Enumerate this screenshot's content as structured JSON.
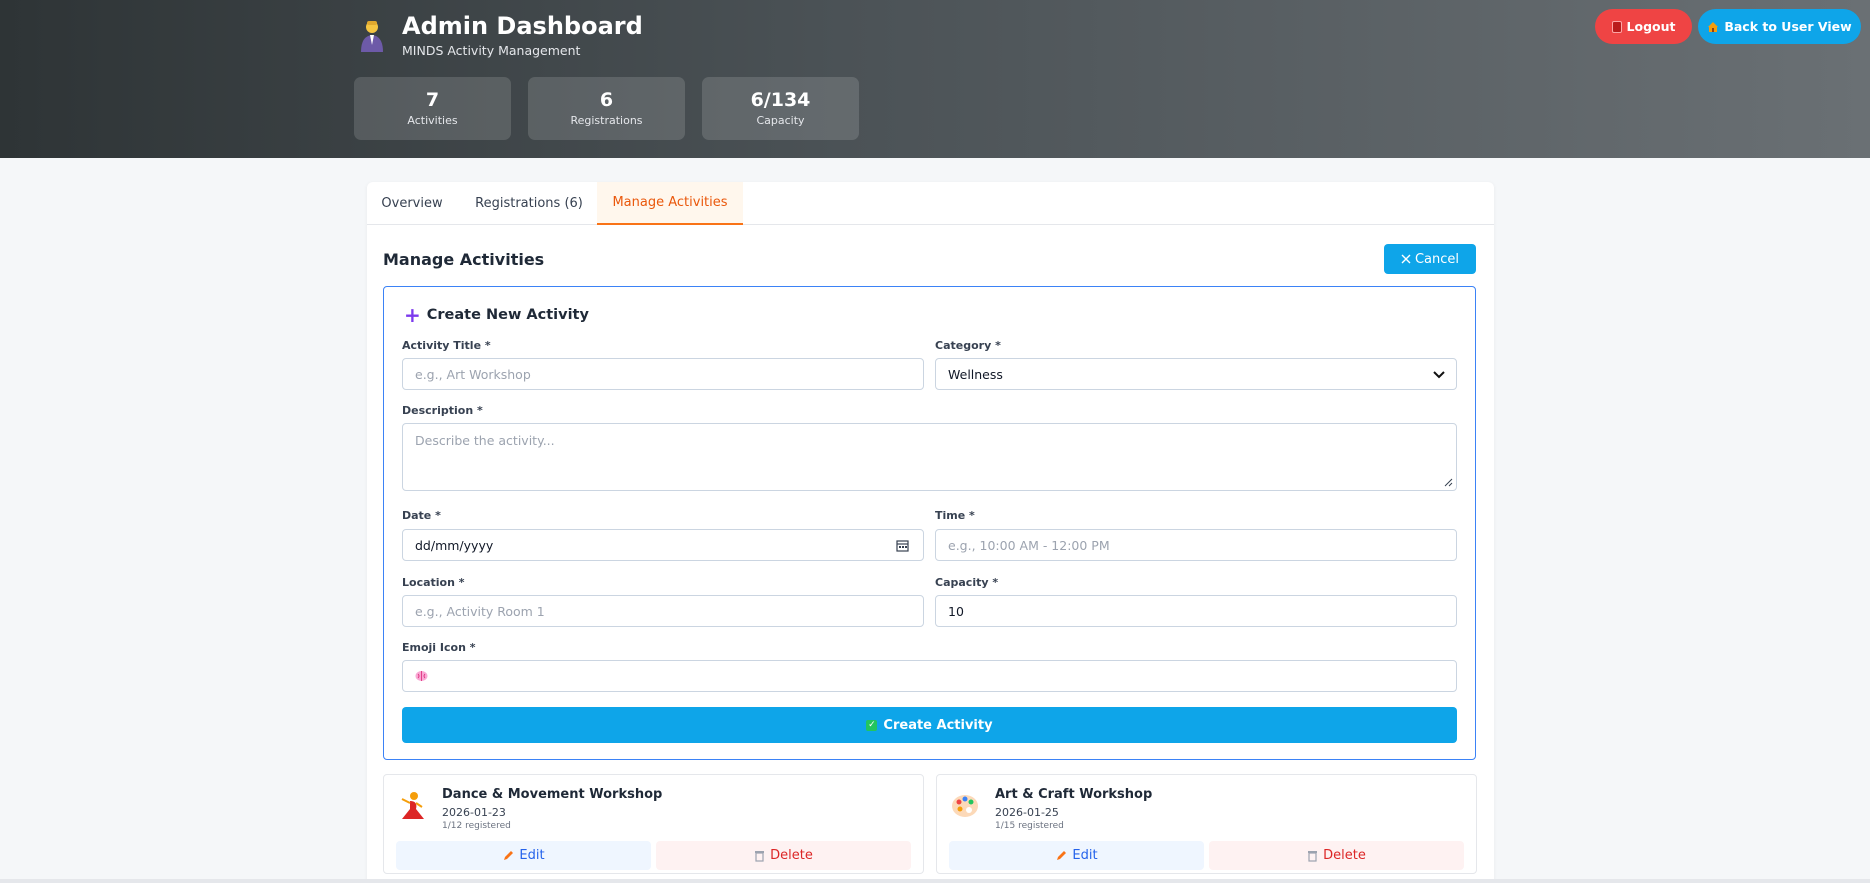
{
  "header": {
    "title": "Admin Dashboard",
    "subtitle": "MINDS Activity Management",
    "icon": "admin-person-icon",
    "logout_label": "Logout",
    "back_label": "Back to User View",
    "stats": [
      {
        "value": "7",
        "label": "Activities"
      },
      {
        "value": "6",
        "label": "Registrations"
      },
      {
        "value": "6/134",
        "label": "Capacity"
      }
    ]
  },
  "tabs": [
    {
      "label": "Overview"
    },
    {
      "label": "Registrations (6)"
    },
    {
      "label": "Manage Activities",
      "active": true
    }
  ],
  "manage": {
    "title": "Manage Activities",
    "cancel_label": "Cancel"
  },
  "form": {
    "heading": "Create New Activity",
    "title_label": "Activity Title *",
    "title_placeholder": "e.g., Art Workshop",
    "category_label": "Category *",
    "category_value": "Wellness",
    "description_label": "Description *",
    "description_placeholder": "Describe the activity...",
    "date_label": "Date *",
    "date_value": "dd/mm/yyyy",
    "time_label": "Time *",
    "time_placeholder": "e.g., 10:00 AM - 12:00 PM",
    "location_label": "Location *",
    "location_placeholder": "e.g., Activity Room 1",
    "capacity_label": "Capacity *",
    "capacity_value": "10",
    "emoji_label": "Emoji Icon *",
    "emoji_value": "brain-icon",
    "submit_label": "Create Activity"
  },
  "activities": [
    {
      "title": "Dance & Movement Workshop",
      "date": "2026-01-23",
      "registered": "1/12 registered",
      "icon": "dancer-icon",
      "edit_label": "Edit",
      "delete_label": "Delete"
    },
    {
      "title": "Art & Craft Workshop",
      "date": "2026-01-25",
      "registered": "1/15 registered",
      "icon": "palette-icon",
      "edit_label": "Edit",
      "delete_label": "Delete"
    }
  ],
  "colors": {
    "accent": "#0ea5e9",
    "danger": "#ef4444",
    "active_tab": "#f97316",
    "form_border": "#3b82f6"
  }
}
